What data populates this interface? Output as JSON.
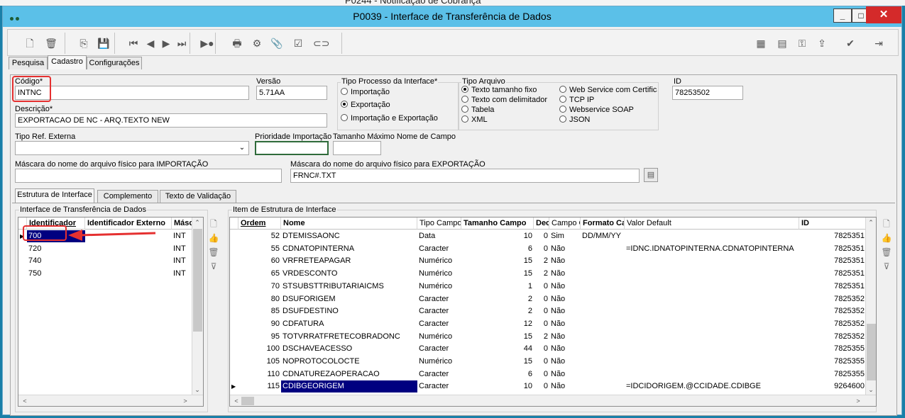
{
  "background_window_title": "P0244 - Notificação de Cobrança",
  "window": {
    "title": "P0039 - Interface de Transferência de Dados",
    "minimize": "_",
    "maximize": "□",
    "close": "✕"
  },
  "toolbar_icons": [
    "new-document-icon",
    "delete-icon",
    "copy-icon",
    "save-icon",
    "first-record-icon",
    "previous-record-icon",
    "next-record-icon",
    "last-record-icon",
    "execute-icon",
    "print-icon",
    "settings-icon",
    "attach-icon",
    "check-icon",
    "link-icon",
    "calculator-icon",
    "table-icon",
    "key-icon",
    "export-icon",
    "confirm-icon",
    "exit-icon"
  ],
  "main_tabs": [
    "Pesquisa",
    "Cadastro",
    "Configurações"
  ],
  "form": {
    "codigo_label": "Código*",
    "codigo_value": "INTNC",
    "versao_label": "Versão",
    "versao_value": "5.71AA",
    "descricao_label": "Descrição*",
    "descricao_value": "EXPORTACAO DE NC - ARQ.TEXTO NEW",
    "tipo_ref_label": "Tipo Ref. Externa",
    "tipo_ref_value": "",
    "prioridade_label": "Prioridade Importação",
    "prioridade_value": "",
    "tamanho_label": "Tamanho Máximo Nome de Campo",
    "tamanho_value": "",
    "mascara_imp_label": "Máscara do nome do arquivo físico para IMPORTAÇÃO",
    "mascara_imp_value": "",
    "mascara_exp_label": "Máscara do nome do arquivo físico para EXPORTAÇÃO",
    "mascara_exp_value": "FRNC#.TXT",
    "id_label": "ID",
    "id_value": "78253502"
  },
  "tipo_processo": {
    "label": "Tipo Processo da Interface*",
    "options": [
      "Importação",
      "Exportação",
      "Importação e Exportação"
    ],
    "selected": 1
  },
  "tipo_arquivo": {
    "label": "Tipo Arquivo",
    "options_col1": [
      "Texto tamanho fixo",
      "Texto com delimitador",
      "Tabela",
      "XML"
    ],
    "options_col2": [
      "Web Service com Certifica",
      "TCP IP",
      "Webservice SOAP",
      "JSON"
    ],
    "selected": "Texto tamanho fixo"
  },
  "sub_tabs": [
    "Estrutura de Interface",
    "Complemento",
    "Texto de Validação"
  ],
  "left_grid": {
    "title": "Interface de Transferência de Dados",
    "headers": [
      "Identificador",
      "Identificador Externo",
      "Máscara"
    ],
    "rows": [
      {
        "id": "700",
        "ext": "",
        "mask": "INTN",
        "selected": true
      },
      {
        "id": "720",
        "ext": "",
        "mask": "INTN",
        "selected": false
      },
      {
        "id": "740",
        "ext": "",
        "mask": "INTN",
        "selected": false
      },
      {
        "id": "750",
        "ext": "",
        "mask": "INTN",
        "selected": false
      }
    ]
  },
  "right_grid": {
    "title": "Item de Estrutura de Interface",
    "headers": [
      "Ordem",
      "Nome",
      "Tipo Campo",
      "Tamanho Campo",
      "Decimais",
      "Campo Obrigatório",
      "Formato Campo",
      "Valor Default",
      "ID"
    ],
    "rows": [
      {
        "ordem": "52",
        "nome": "DTEMISSAONC",
        "tipo": "Data",
        "tam": "10",
        "dec": "0",
        "obrig": "Sim",
        "fmt": "DD/MM/YY",
        "def": "",
        "id": "7825351"
      },
      {
        "ordem": "55",
        "nome": "CDNATOPINTERNA",
        "tipo": "Caracter",
        "tam": "6",
        "dec": "0",
        "obrig": "Não",
        "fmt": "",
        "def": "=IDNC.IDNATOPINTERNA.CDNATOPINTERNA",
        "id": "7825351"
      },
      {
        "ordem": "60",
        "nome": "VRFRETEAPAGAR",
        "tipo": "Numérico",
        "tam": "15",
        "dec": "2",
        "obrig": "Não",
        "fmt": "",
        "def": "",
        "id": "7825351"
      },
      {
        "ordem": "65",
        "nome": "VRDESCONTO",
        "tipo": "Numérico",
        "tam": "15",
        "dec": "2",
        "obrig": "Não",
        "fmt": "",
        "def": "",
        "id": "7825351"
      },
      {
        "ordem": "70",
        "nome": "STSUBSTTRIBUTARIAICMS",
        "tipo": "Numérico",
        "tam": "1",
        "dec": "0",
        "obrig": "Não",
        "fmt": "",
        "def": "",
        "id": "7825351"
      },
      {
        "ordem": "80",
        "nome": "DSUFORIGEM",
        "tipo": "Caracter",
        "tam": "2",
        "dec": "0",
        "obrig": "Não",
        "fmt": "",
        "def": "",
        "id": "7825352"
      },
      {
        "ordem": "85",
        "nome": "DSUFDESTINO",
        "tipo": "Caracter",
        "tam": "2",
        "dec": "0",
        "obrig": "Não",
        "fmt": "",
        "def": "",
        "id": "7825352"
      },
      {
        "ordem": "90",
        "nome": "CDFATURA",
        "tipo": "Caracter",
        "tam": "12",
        "dec": "0",
        "obrig": "Não",
        "fmt": "",
        "def": "",
        "id": "7825352"
      },
      {
        "ordem": "95",
        "nome": "TOTVRRATFRETECOBRADONC",
        "tipo": "Numérico",
        "tam": "15",
        "dec": "2",
        "obrig": "Não",
        "fmt": "",
        "def": "",
        "id": "7825352"
      },
      {
        "ordem": "100",
        "nome": "DSCHAVEACESSO",
        "tipo": "Caracter",
        "tam": "44",
        "dec": "0",
        "obrig": "Não",
        "fmt": "",
        "def": "",
        "id": "7825355"
      },
      {
        "ordem": "105",
        "nome": "NOPROTOCOLOCTE",
        "tipo": "Numérico",
        "tam": "15",
        "dec": "0",
        "obrig": "Não",
        "fmt": "",
        "def": "",
        "id": "7825355"
      },
      {
        "ordem": "110",
        "nome": "CDNATUREZAOPERACAO",
        "tipo": "Caracter",
        "tam": "6",
        "dec": "0",
        "obrig": "Não",
        "fmt": "",
        "def": "",
        "id": "7825355"
      },
      {
        "ordem": "115",
        "nome": "CDIBGEORIGEM",
        "tipo": "Caracter",
        "tam": "10",
        "dec": "0",
        "obrig": "Não",
        "fmt": "",
        "def": "=IDCIDORIGEM.@CCIDADE.CDIBGE",
        "id": "9264600"
      }
    ],
    "selected_row": 12
  },
  "colors": {
    "titlebar": "#5bc0e8",
    "selection": "#000080",
    "highlight": "#e53030",
    "close": "#d42a2a"
  }
}
